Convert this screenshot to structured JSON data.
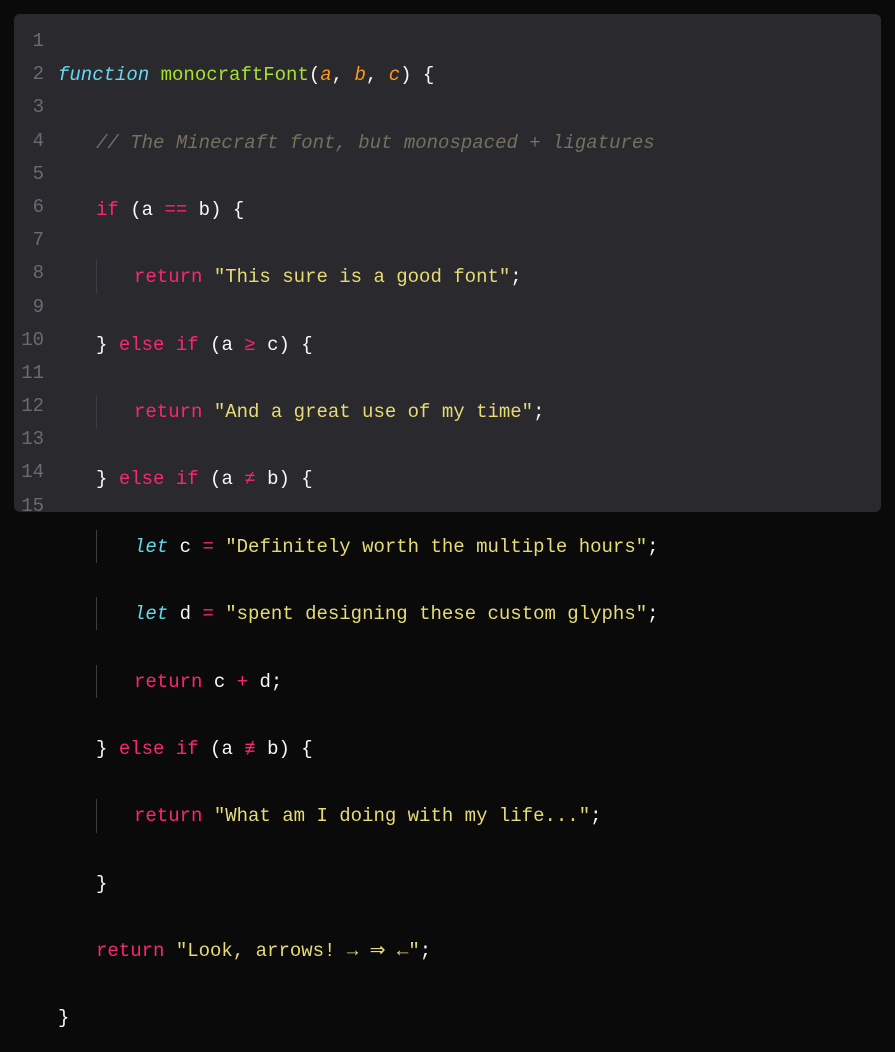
{
  "colors": {
    "bg": "#0a0a0a",
    "editor_bg": "#2a292e",
    "gutter": "#6b6a70",
    "keyword_fn": "#66d9ef",
    "fn_name": "#a6e22e",
    "param": "#fd971f",
    "keyword": "#f92672",
    "string": "#e6db74",
    "comment": "#75715e",
    "text": "#f8f8f2"
  },
  "line_numbers": [
    "1",
    "2",
    "3",
    "4",
    "5",
    "6",
    "7",
    "8",
    "9",
    "10",
    "11",
    "12",
    "13",
    "14",
    "15"
  ],
  "code": {
    "l1": {
      "kw": "function",
      "name": "monocraftFont",
      "params": [
        "a",
        "b",
        "c"
      ]
    },
    "l2": {
      "comment": "// The Minecraft font, but monospaced + ligatures"
    },
    "l3": {
      "kw": "if",
      "left": "a",
      "op": "==",
      "right": "b"
    },
    "l4": {
      "kw": "return",
      "str": "\"This sure is a good font\""
    },
    "l5": {
      "kw1": "else",
      "kw2": "if",
      "left": "a",
      "op": "≥",
      "right": "c"
    },
    "l6": {
      "kw": "return",
      "str": "\"And a great use of my time\""
    },
    "l7": {
      "kw1": "else",
      "kw2": "if",
      "left": "a",
      "op": "≠",
      "right": "b"
    },
    "l8": {
      "kw": "let",
      "var": "c",
      "str": "\"Definitely worth the multiple hours\""
    },
    "l9": {
      "kw": "let",
      "var": "d",
      "str": "\"spent designing these custom glyphs\""
    },
    "l10": {
      "kw": "return",
      "left": "c",
      "op": "+",
      "right": "d"
    },
    "l11": {
      "kw1": "else",
      "kw2": "if",
      "left": "a",
      "op": "≢",
      "right": "b"
    },
    "l12": {
      "kw": "return",
      "str": "\"What am I doing with my life...\""
    },
    "l14": {
      "kw": "return",
      "str": "\"Look, arrows! → ⇒ ←\""
    }
  }
}
